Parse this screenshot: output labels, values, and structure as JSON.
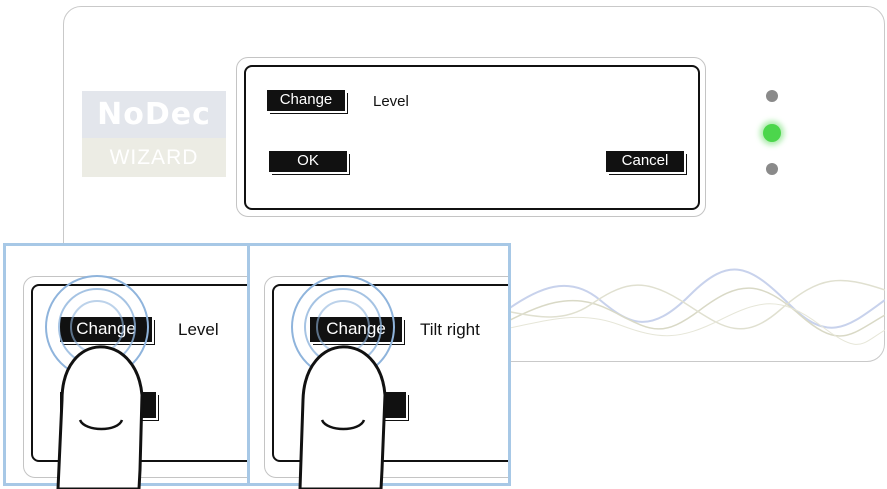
{
  "logo": {
    "brand": "NoDec",
    "subtitle": "WIZARD"
  },
  "lcd": {
    "change_button": "Change",
    "setting_value": "Level",
    "ok_button": "OK",
    "cancel_button": "Cancel"
  },
  "indicators": {
    "top": "off",
    "middle": "on",
    "bottom": "off",
    "active_color": "#4cd64c"
  },
  "steps": [
    {
      "button": "Change",
      "value": "Level"
    },
    {
      "button": "Change",
      "value": "Tilt right"
    }
  ],
  "colors": {
    "panel_border": "#a7c8e6",
    "touch_ring": "#8fb4dc"
  }
}
